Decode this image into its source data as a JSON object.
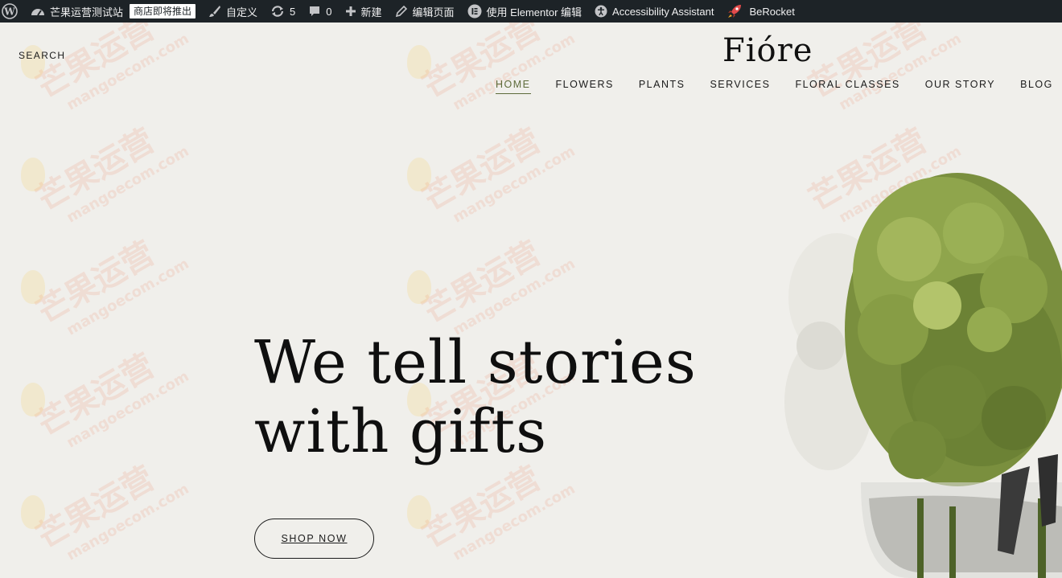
{
  "adminbar": {
    "site_name": "芒果运营测试站",
    "badge": "商店即将推出",
    "customize": "自定义",
    "updates_count": "5",
    "comments_count": "0",
    "new": "新建",
    "edit_page": "编辑页面",
    "elementor": "使用 Elementor 编辑",
    "accessibility": "Accessibility Assistant",
    "berocket": "BeRocket"
  },
  "header": {
    "search": "SEARCH",
    "logo": "Fióre",
    "nav": [
      {
        "label": "HOME",
        "active": true
      },
      {
        "label": "FLOWERS"
      },
      {
        "label": "PLANTS"
      },
      {
        "label": "SERVICES"
      },
      {
        "label": "FLORAL CLASSES"
      },
      {
        "label": "OUR STORY"
      },
      {
        "label": "BLOG"
      }
    ]
  },
  "hero": {
    "title_line1": "We tell stories",
    "title_line2": "with gifts",
    "button": "SHOP NOW"
  },
  "watermark": {
    "cn": "芒果运营",
    "en": "mangoecom.com"
  },
  "colors": {
    "background": "#f0efeb",
    "adminbar": "#1d2327",
    "accent": "#5d6b3a"
  }
}
